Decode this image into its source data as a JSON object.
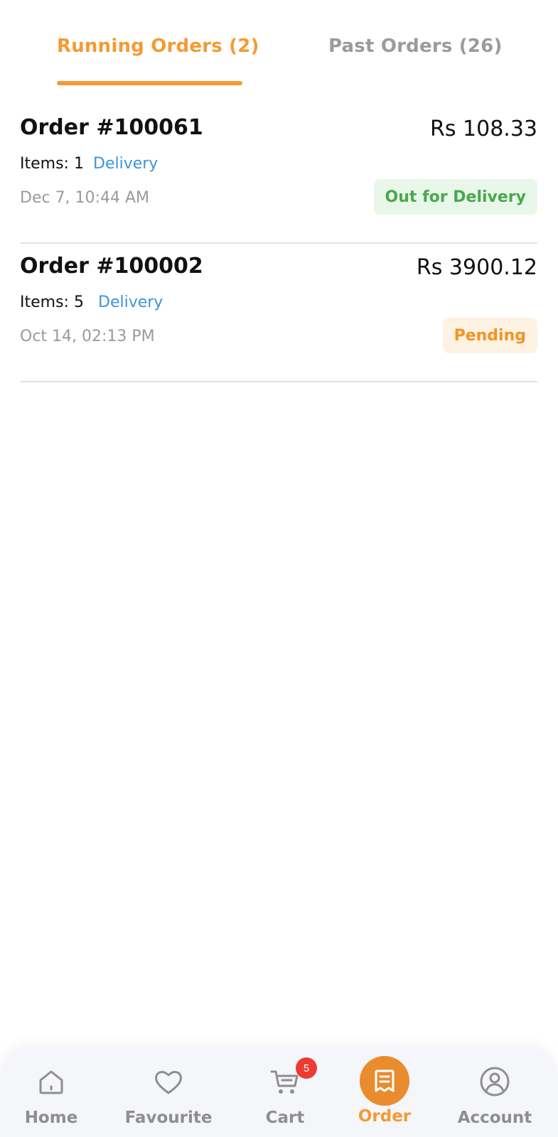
{
  "tabs": {
    "running_label": "Running Orders (2)",
    "past_label": "Past Orders (26)",
    "active_color": "#F39B33",
    "inactive_color": "#9B9B9B"
  },
  "orders": [
    {
      "title": "Order #100061",
      "price": "Rs 108.33",
      "items": "Items: 1",
      "method": "Delivery",
      "date": "Dec 7, 10:44 AM",
      "status": "Out for Delivery",
      "status_color": "#49A84C"
    },
    {
      "title": "Order #100002",
      "price": "Rs 3900.12",
      "items": "Items: 5",
      "method": "Delivery",
      "date": "Oct 14, 02:13 PM",
      "status": "Pending",
      "status_color": "#F39422"
    }
  ],
  "bottom_nav": {
    "items": [
      {
        "label": "Home",
        "icon": "home-icon"
      },
      {
        "label": "Favourite",
        "icon": "heart-icon"
      },
      {
        "label": "Cart",
        "icon": "cart-icon",
        "badge": "5"
      },
      {
        "label": "Order",
        "icon": "receipt-icon",
        "active": true
      },
      {
        "label": "Account",
        "icon": "user-circle-icon"
      }
    ]
  },
  "colors": {
    "accent": "#F39B33",
    "link": "#3B95DA",
    "badge_red": "#EE3A33"
  }
}
